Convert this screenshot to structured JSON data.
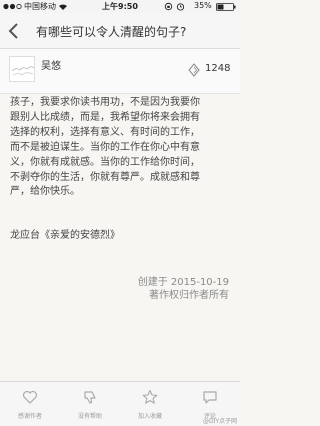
{
  "status_bar": {
    "carrier": "中国移动",
    "time": "上午9:50",
    "battery_percent": "35%"
  },
  "nav": {
    "title": "有哪些可以令人清醒的句子?"
  },
  "answer": {
    "author_name": "吴悠",
    "vote_count": "1248",
    "paragraph_lines": [
      "孩子，我要求你读书用功，不是因为我要你",
      "跟别人比成绩，而是，我希望你将来会拥有",
      "选择的权利，选择有意义、有时间的工作，",
      "而不是被迫谋生。当你的工作在你心中有意",
      "义，你就有成就感。当你的工作给你时间，",
      "不剥夺你的生活，你就有尊严。成就感和尊",
      "严，给你快乐。"
    ],
    "source": "龙应台《亲爱的安德烈》",
    "created_at": "创建于 2015-10-19",
    "copyright": "著作权归作者所有"
  },
  "tab_bar": {
    "tabs": [
      {
        "label": "感谢作者",
        "icon": "heart-icon"
      },
      {
        "label": "没有帮助",
        "icon": "thumbs-down-icon"
      },
      {
        "label": "加入收藏",
        "icon": "star-icon"
      },
      {
        "label": "评论",
        "icon": "comment-icon"
      }
    ],
    "watermark": "@DIY点子网"
  },
  "colors": {
    "page_background": "#f7f6f2",
    "body_text": "#444444",
    "meta_text": "#8a8a8a",
    "tab_icon": "#aaaaaa"
  }
}
